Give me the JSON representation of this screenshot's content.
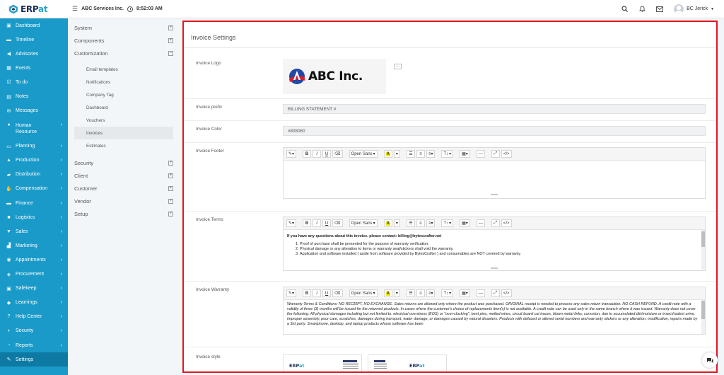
{
  "header": {
    "logo_text": "ERPat",
    "company": "ABC Services Inc.",
    "time": "8:52:03 AM",
    "user_name": "BC Jerick"
  },
  "sidebar": {
    "items": [
      {
        "label": "Dashboard",
        "icon": "dashboard-icon",
        "glyph": "▣",
        "chevron": false
      },
      {
        "label": "Timeline",
        "icon": "timeline-icon",
        "glyph": "▬",
        "chevron": false
      },
      {
        "label": "Advisories",
        "icon": "megaphone-icon",
        "glyph": "◀",
        "chevron": false
      },
      {
        "label": "Events",
        "icon": "calendar-icon",
        "glyph": "▦",
        "chevron": false
      },
      {
        "label": "To do",
        "icon": "checkbox-icon",
        "glyph": "☑",
        "chevron": false
      },
      {
        "label": "Notes",
        "icon": "notes-icon",
        "glyph": "▤",
        "chevron": false
      },
      {
        "label": "Messages",
        "icon": "envelope-icon",
        "glyph": "✉",
        "chevron": false
      },
      {
        "label": "Human Resource",
        "icon": "users-icon",
        "glyph": "●",
        "chevron": true
      },
      {
        "label": "Planning",
        "icon": "planning-icon",
        "glyph": "▭",
        "chevron": true
      },
      {
        "label": "Production",
        "icon": "flask-icon",
        "glyph": "▲",
        "chevron": true
      },
      {
        "label": "Distribution",
        "icon": "truck-icon",
        "glyph": "▰",
        "chevron": true
      },
      {
        "label": "Compensation",
        "icon": "handshake-icon",
        "glyph": "✋",
        "chevron": true
      },
      {
        "label": "Finance",
        "icon": "money-icon",
        "glyph": "▬",
        "chevron": true
      },
      {
        "label": "Logistics",
        "icon": "box-icon",
        "glyph": "■",
        "chevron": true
      },
      {
        "label": "Sales",
        "icon": "cart-icon",
        "glyph": "▼",
        "chevron": true
      },
      {
        "label": "Marketing",
        "icon": "chart-icon",
        "glyph": "▟",
        "chevron": true
      },
      {
        "label": "Appointments",
        "icon": "appointments-icon",
        "glyph": "◉",
        "chevron": true
      },
      {
        "label": "Procurement",
        "icon": "procurement-icon",
        "glyph": "◈",
        "chevron": true
      },
      {
        "label": "Safekeep",
        "icon": "archive-icon",
        "glyph": "▣",
        "chevron": true
      },
      {
        "label": "Learnings",
        "icon": "graduation-cap-icon",
        "glyph": "◆",
        "chevron": true
      },
      {
        "label": "Help Center",
        "icon": "help-icon",
        "glyph": "?",
        "chevron": true
      },
      {
        "label": "Security",
        "icon": "shield-icon",
        "glyph": "◗",
        "chevron": true
      },
      {
        "label": "Reports",
        "icon": "reports-icon",
        "glyph": "◔",
        "chevron": true
      },
      {
        "label": "Settings",
        "icon": "wrench-icon",
        "glyph": "✎",
        "chevron": false,
        "active": true
      }
    ]
  },
  "submenu": {
    "groups_top": [
      {
        "label": "System",
        "toggle": "+"
      },
      {
        "label": "Components",
        "toggle": "+"
      },
      {
        "label": "Customization",
        "toggle": "−"
      }
    ],
    "children": [
      {
        "label": "Email templates"
      },
      {
        "label": "Notifications"
      },
      {
        "label": "Company Tag"
      },
      {
        "label": "Dashboard"
      },
      {
        "label": "Vouchers"
      },
      {
        "label": "Invoices",
        "active": true
      },
      {
        "label": "Estimates"
      }
    ],
    "groups_bottom": [
      {
        "label": "Security",
        "toggle": "+"
      },
      {
        "label": "Client",
        "toggle": "+"
      },
      {
        "label": "Customer",
        "toggle": "+"
      },
      {
        "label": "Vendor",
        "toggle": "+"
      },
      {
        "label": "Setup",
        "toggle": "+"
      }
    ]
  },
  "invoice_settings": {
    "title": "Invoice Settings",
    "logo_label": "Invoice Logo",
    "logo_text": "ABC Inc.",
    "logo_menu": "...",
    "prefix_label": "Invoice prefix",
    "prefix_value": "BILLING STATEMENT #",
    "color_label": "Invoice Color",
    "color_value": "#808080",
    "footer_label": "Invoice Footer",
    "terms_label": "Invoice Terms",
    "warranty_label": "Invoice Warranty",
    "style_label": "Invoice style",
    "style_logo_text": "ERPat"
  },
  "editor_toolbar": {
    "font_name": "Open Sans",
    "bold": "B",
    "italic": "I",
    "underline": "U",
    "highlight": "A",
    "text_size": "T↕",
    "code": "</>"
  },
  "terms": {
    "heading": "If you have any questions about this invoice, please contact: billing@bytescrafter.net",
    "items": [
      "Proof of purchase shall be presented for the purpose of warranty verification.",
      "Physical damage or any alteration to items or warranty seal/stickers shall void the warranty.",
      "Application and software installed ( aside from software provided by BytesCrafter ) and consumables are NOT covered by warranty."
    ]
  },
  "warranty": {
    "text": "Warranty Terms & Conditions: NO RECEIPT, NO EXCHANGE. Sales returns are allowed only where the product was purchased. ORIGINAL receipt is needed to process any sales return transaction. NO CASH REFUND. A credit note with a validity of three (3) months will be issued for the returned products. In cases where the customer's choice of replacements item(s) is not available. A credit note can be used only in the same branch where it was issued. Warranty does not cover the following: All physical damages including but not limited to: electrical overstress (EOS) or \"over-clocking\", bent pins, melted wires, circuit board cut traces, blown metal links, corrosion, due to accumulated dirt/moisture or insect/rodent urine, improper assembly, poor care, scratches, damages during transport, water damage, or damages caused by natural disasters. Products with defaced or altered serial numbers and warranty stickers or any alteration, modification, repairs made by a 3rd party. Smartphone, desktop, and laptop products whose software has been"
  },
  "colors": {
    "sidebar_bg": "#1a9ac9",
    "sidebar_active": "#0e7aa3",
    "highlight_border": "#e1171f",
    "brand_dark": "#1b2f59",
    "brand_light": "#2aa3c9"
  }
}
